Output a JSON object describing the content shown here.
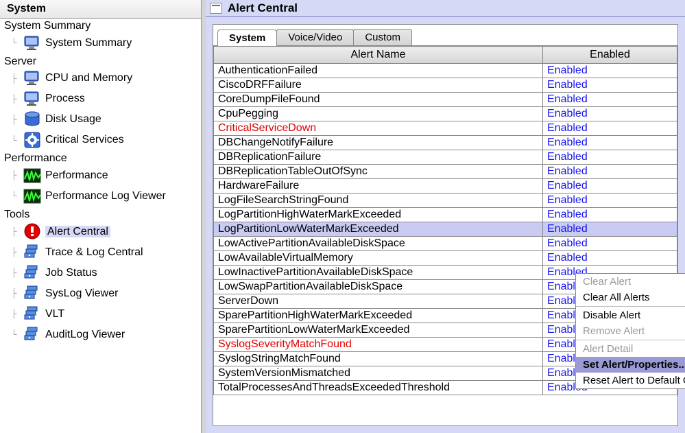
{
  "sidebar": {
    "title": "System",
    "groups": [
      {
        "label": "System Summary",
        "items": [
          {
            "icon": "monitor-blue",
            "label": "System Summary"
          }
        ]
      },
      {
        "label": "Server",
        "items": [
          {
            "icon": "monitor-blue",
            "label": "CPU and Memory"
          },
          {
            "icon": "monitor-blue",
            "label": "Process"
          },
          {
            "icon": "disk-blue",
            "label": "Disk Usage"
          },
          {
            "icon": "gear-blue",
            "label": "Critical Services"
          }
        ]
      },
      {
        "label": "Performance",
        "items": [
          {
            "icon": "wave-green",
            "label": "Performance"
          },
          {
            "icon": "wave-green",
            "label": "Performance Log Viewer"
          }
        ]
      },
      {
        "label": "Tools",
        "items": [
          {
            "icon": "alert-red",
            "label": "Alert Central",
            "selected": true
          },
          {
            "icon": "server-stack",
            "label": "Trace & Log Central"
          },
          {
            "icon": "server-stack",
            "label": "Job Status"
          },
          {
            "icon": "server-stack",
            "label": "SysLog Viewer"
          },
          {
            "icon": "server-stack",
            "label": "VLT"
          },
          {
            "icon": "server-stack",
            "label": "AuditLog Viewer"
          }
        ]
      }
    ]
  },
  "main": {
    "title": "Alert Central",
    "tabs": [
      {
        "label": "System",
        "active": true
      },
      {
        "label": "Voice/Video",
        "active": false
      },
      {
        "label": "Custom",
        "active": false
      }
    ],
    "columns": {
      "name": "Alert Name",
      "enabled": "Enabled"
    },
    "alerts": [
      {
        "name": "AuthenticationFailed",
        "enabled": "Enabled",
        "critical": false
      },
      {
        "name": "CiscoDRFFailure",
        "enabled": "Enabled",
        "critical": false
      },
      {
        "name": "CoreDumpFileFound",
        "enabled": "Enabled",
        "critical": false
      },
      {
        "name": "CpuPegging",
        "enabled": "Enabled",
        "critical": false
      },
      {
        "name": "CriticalServiceDown",
        "enabled": "Enabled",
        "critical": true
      },
      {
        "name": "DBChangeNotifyFailure",
        "enabled": "Enabled",
        "critical": false
      },
      {
        "name": "DBReplicationFailure",
        "enabled": "Enabled",
        "critical": false
      },
      {
        "name": "DBReplicationTableOutOfSync",
        "enabled": "Enabled",
        "critical": false
      },
      {
        "name": "HardwareFailure",
        "enabled": "Enabled",
        "critical": false
      },
      {
        "name": "LogFileSearchStringFound",
        "enabled": "Enabled",
        "critical": false
      },
      {
        "name": "LogPartitionHighWaterMarkExceeded",
        "enabled": "Enabled",
        "critical": false
      },
      {
        "name": "LogPartitionLowWaterMarkExceeded",
        "enabled": "Enabled",
        "critical": false,
        "selected": true
      },
      {
        "name": "LowActivePartitionAvailableDiskSpace",
        "enabled": "Enabled",
        "critical": false,
        "trunc": "LowActivePartitionAvailable"
      },
      {
        "name": "LowAvailableVirtualMemory",
        "enabled": "Enabled",
        "critical": false,
        "trunc": "LowAvailableVirtualMemory"
      },
      {
        "name": "LowInactivePartitionAvailableDiskSpace",
        "enabled": "Enabled",
        "critical": false,
        "trunc": "LowInactivePartitionAvailabl"
      },
      {
        "name": "LowSwapPartitionAvailableDiskSpace",
        "enabled": "Enabled",
        "critical": false,
        "trunc": "LowSwapPartitionAvailableD"
      },
      {
        "name": "ServerDown",
        "enabled": "Enabled",
        "critical": false,
        "trunc": "ServerDown"
      },
      {
        "name": "SparePartitionHighWaterMarkExceeded",
        "enabled": "Enabled",
        "critical": false,
        "trunc": "SparePartitionHighWaterMa"
      },
      {
        "name": "SparePartitionLowWaterMarkExceeded",
        "enabled": "Enabled",
        "critical": false,
        "trunc": "SparePartitionLowWaterMar"
      },
      {
        "name": "SyslogSeverityMatchFound",
        "enabled": "Enabled",
        "critical": true,
        "trunc": "SyslogSeverityMatchFound"
      },
      {
        "name": "SyslogStringMatchFound",
        "enabled": "Enabled",
        "critical": false
      },
      {
        "name": "SystemVersionMismatched",
        "enabled": "Enabled",
        "critical": false
      },
      {
        "name": "TotalProcessesAndThreadsExceededThreshold",
        "enabled": "Enabled",
        "critical": false
      }
    ],
    "context_menu": [
      {
        "label": "Clear Alert",
        "disabled": true
      },
      {
        "label": "Clear All Alerts",
        "disabled": false
      },
      {
        "sep": true
      },
      {
        "label": "Disable Alert",
        "disabled": false
      },
      {
        "label": "Remove Alert",
        "disabled": true
      },
      {
        "sep": true
      },
      {
        "label": "Alert Detail",
        "disabled": true
      },
      {
        "label": "Set Alert/Properties...",
        "disabled": false,
        "highlight": true
      },
      {
        "label": "Reset Alert to Default Config",
        "disabled": false
      }
    ],
    "enabled_col_trunc": "nabled"
  }
}
